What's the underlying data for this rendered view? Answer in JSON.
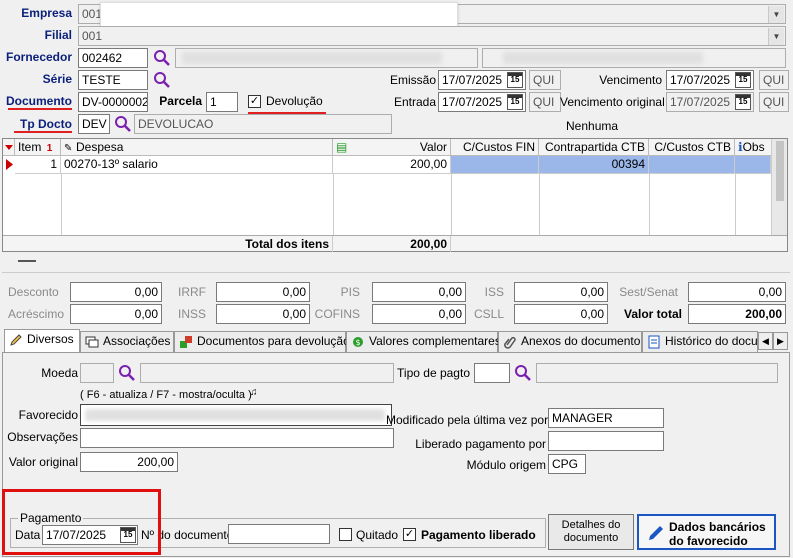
{
  "header": {
    "empresa_label": "Empresa",
    "empresa_value": "001",
    "filial_label": "Filial",
    "filial_value": "001",
    "fornecedor_label": "Fornecedor",
    "fornecedor_code": "002462",
    "serie_label": "Série",
    "serie_value": "TESTE",
    "documento_label": "Documento",
    "documento_value": "DV-0000002",
    "parcela_label": "Parcela",
    "parcela_value": "1",
    "devolucao_label": "Devolução",
    "devolucao_checked": "✓",
    "tpdocto_label": "Tp Docto",
    "tpdocto_code": "DEV",
    "tpdocto_desc": "DEVOLUCAO",
    "emissao_label": "Emissão",
    "emissao_value": "17/07/2025",
    "emissao_day": "QUI",
    "entrada_label": "Entrada",
    "entrada_value": "17/07/2025",
    "entrada_day": "QUI",
    "vencimento_label": "Vencimento",
    "vencimento_value": "17/07/2025",
    "vencimento_day": "QUI",
    "venc_original_label": "Vencimento original",
    "venc_original_value": "17/07/2025",
    "venc_original_day": "QUI",
    "nenhuma": "Nenhuma",
    "cal_label": "15"
  },
  "grid": {
    "columns": [
      "Item",
      "Despesa",
      "Valor",
      "C/Custos FIN",
      "Contrapartida CTB",
      "C/Custos CTB",
      "Obs"
    ],
    "item_sort": "1",
    "rows": [
      {
        "item": "1",
        "despesa": "00270-13º salario",
        "valor": "200,00",
        "ccfin": "",
        "contrapartida": "00394",
        "ccctb": ""
      }
    ],
    "total_label": "Total dos itens",
    "total_value": "200,00"
  },
  "totals": {
    "desconto_label": "Desconto",
    "desconto": "0,00",
    "irrf_label": "IRRF",
    "irrf": "0,00",
    "pis_label": "PIS",
    "pis": "0,00",
    "iss_label": "ISS",
    "iss": "0,00",
    "sest_label": "Sest/Senat",
    "sest": "0,00",
    "acrescimo_label": "Acréscimo",
    "acrescimo": "0,00",
    "inss_label": "INSS",
    "inss": "0,00",
    "cofins_label": "COFINS",
    "cofins": "0,00",
    "csll_label": "CSLL",
    "csll": "0,00",
    "valor_total_label": "Valor total",
    "valor_total": "200,00"
  },
  "tabs": {
    "diversos": "Diversos",
    "associacoes": "Associações",
    "docs_devolucao": "Documentos para devolução",
    "valores_compl": "Valores complementares",
    "anexos": "Anexos do documento",
    "historico": "Histórico do docum"
  },
  "panel": {
    "moeda_label": "Moeda",
    "tipo_pagto_label": "Tipo de pagto",
    "hint": "( F6 - atualiza / F7 - mostra/oculta )",
    "favorecido_label": "Favorecido",
    "observacoes_label": "Observações",
    "valor_original_label": "Valor original",
    "valor_original": "200,00",
    "modificado_label": "Modificado pela última vez por",
    "modificado_value": "MANAGER",
    "liberado_label": "Liberado pagamento por",
    "modulo_label": "Módulo origem",
    "modulo_value": "CPG"
  },
  "pagamento": {
    "group_label": "Pagamento",
    "data_label": "Data",
    "data_value": "17/07/2025",
    "nro_doc_label": "Nº do documento",
    "quitado_label": "Quitado",
    "liberado_label": "Pagamento liberado",
    "liberado_checked": "✓",
    "detalhes_button": "Detalhes do documento",
    "dados_bancarios_button": "Dados bancários do favorecido"
  }
}
